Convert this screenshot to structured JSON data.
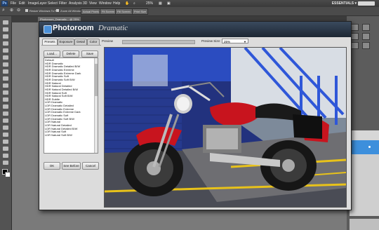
{
  "app": {
    "logo": "Ps",
    "menus": [
      "File",
      "Edit",
      "Image",
      "Layer",
      "Select",
      "Filter",
      "Analysis",
      "3D",
      "View",
      "Window",
      "Help"
    ],
    "zoom": "25%",
    "workspace": "ESSENTIALS ▾"
  },
  "options": {
    "resize_windows": "Resize Windows To Fit",
    "zoom_all": "Zoom All Windows",
    "actual_pixels": "Actual Pixels",
    "fit_screen": "Fit Screen",
    "fill_screen": "Fill Screen",
    "print_size": "Print Size"
  },
  "document_tab": "Photoroom_Dramatic... @ 25%",
  "dialog": {
    "logo_main": "Photoroom",
    "logo_sub": "Dramatic",
    "tabs": [
      "Presets",
      "Exposure",
      "Detail",
      "Color"
    ],
    "active_tab": "Presets",
    "preview_label": "Preview",
    "preview_size_label": "Preview Size:",
    "preview_size_value": "25%",
    "load_label": "Load...",
    "delete_label": "Delete",
    "save_label": "Save",
    "presets": [
      "Default",
      "HDR Dramatic",
      "HDR Dramatic Detailed B/W",
      "HDR Dramatic Extreme",
      "HDR Dramatic Extreme Dark",
      "HDR Dramatic Soft",
      "HDR Dramatic Soft B/W",
      "HDR Natural",
      "HDR Natural Detailed",
      "HDR Natural Detailed B/W",
      "HDR Natural Soft",
      "HDR Natural Soft B/W",
      "HDR Subtle",
      "LDR Dramatic",
      "LDR Dramatic Detailed",
      "LDR Dramatic Extreme",
      "LDR Dramatic Extreme Dark",
      "LDR Dramatic Soft",
      "LDR Dramatic Soft B/W",
      "LDR Natural",
      "LDR Natural Detailed",
      "LDR Natural Detailed B/W",
      "LDR Natural Soft",
      "LDR Natural Soft B/W"
    ],
    "ok_label": "OK",
    "see_before_label": "See Before",
    "cancel_label": "Cancel"
  },
  "colors": {
    "accent": "#3d8fdc",
    "bike_red": "#c8141e",
    "wall_blue": "#2a3f9a",
    "stripe_yellow": "#e8c21a"
  }
}
